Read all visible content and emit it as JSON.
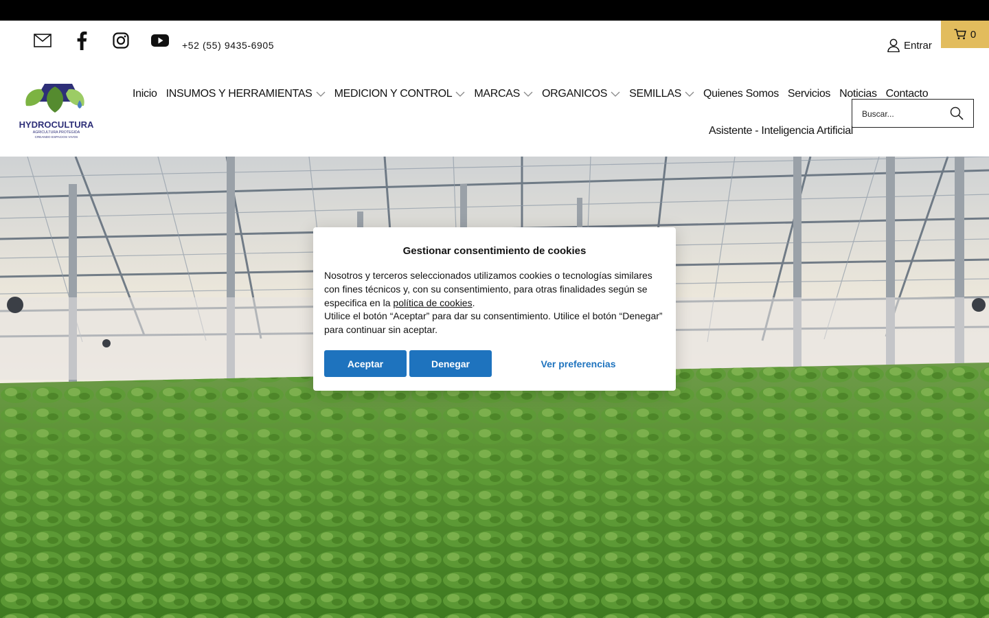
{
  "utility": {
    "phone": "+52 (55) 9435-6905",
    "login_label": "Entrar",
    "cart_count": "0"
  },
  "nav": {
    "items": [
      {
        "label": "Inicio",
        "dropdown": false
      },
      {
        "label": "INSUMOS Y HERRAMIENTAS",
        "dropdown": true
      },
      {
        "label": "MEDICION Y CONTROL",
        "dropdown": true
      },
      {
        "label": "MARCAS",
        "dropdown": true
      },
      {
        "label": "ORGANICOS",
        "dropdown": true
      },
      {
        "label": "SEMILLAS",
        "dropdown": true
      },
      {
        "label": "Quienes Somos",
        "dropdown": false
      },
      {
        "label": "Servicios",
        "dropdown": false
      },
      {
        "label": "Noticias",
        "dropdown": false
      },
      {
        "label": "Contacto",
        "dropdown": false
      }
    ],
    "second_row": "Asistente - Inteligencia Artificial"
  },
  "logo": {
    "wordmark": "HYDROCULTURA",
    "tagline": "AGRICULTURA PROTEGIDA",
    "subtagline": "CREANDO ESPACIOS VIVOS"
  },
  "search": {
    "placeholder": "Buscar..."
  },
  "cookie_modal": {
    "title": "Gestionar consentimiento de cookies",
    "text_before_link": "Nosotros y terceros seleccionados utilizamos cookies o tecnologías similares con fines técnicos y, con su consentimiento, para otras finalidades según se especifica en la ",
    "link_text": "política de cookies",
    "text_after_link": ".",
    "text_second": "Utilice el botón “Aceptar” para dar su consentimiento. Utilice el botón “Denegar” para continuar sin aceptar.",
    "accept_label": "Aceptar",
    "deny_label": "Denegar",
    "prefs_label": "Ver preferencias"
  },
  "colors": {
    "accent_blue": "#1e73be",
    "cart_gold": "#e2bc5d",
    "topbar": "#000000"
  }
}
